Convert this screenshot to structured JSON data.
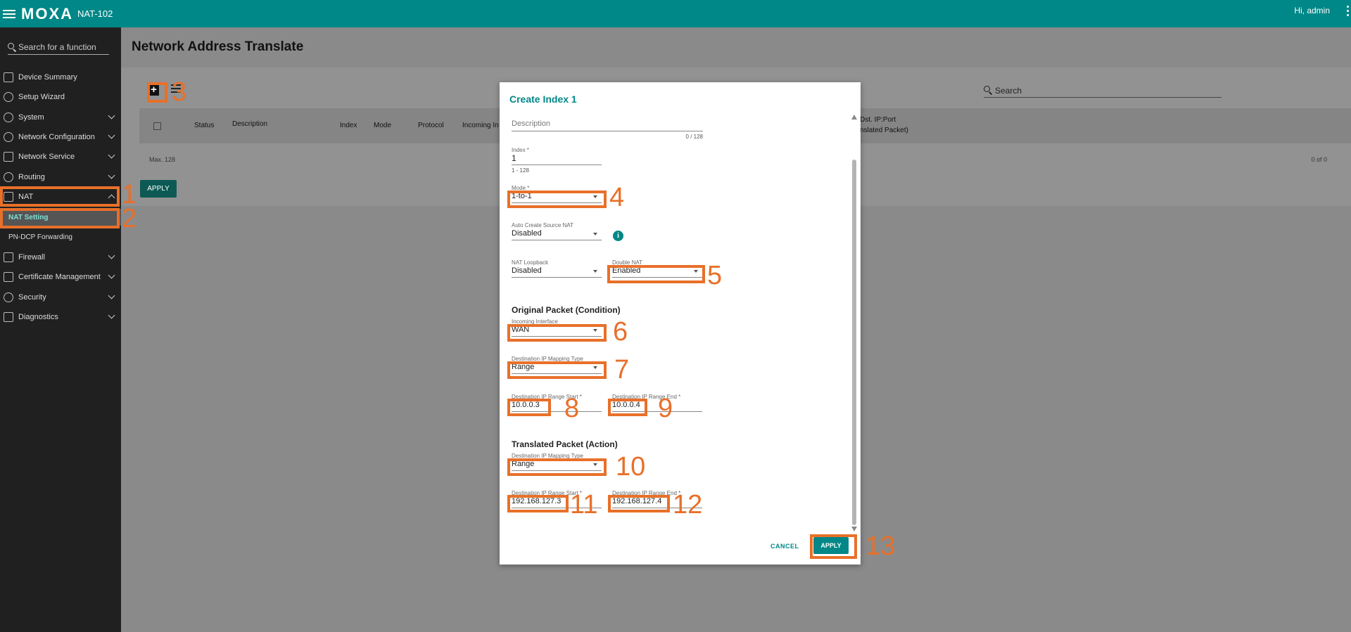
{
  "header": {
    "brand": "MOXA",
    "model": "NAT-102",
    "user_greeting": "Hi, admin"
  },
  "sidebar": {
    "search_placeholder": "Search for a function",
    "items": [
      {
        "label": "Device Summary",
        "icon": "device-summary-icon"
      },
      {
        "label": "Setup Wizard",
        "icon": "wand-icon"
      },
      {
        "label": "System",
        "icon": "gear-icon"
      },
      {
        "label": "Network Configuration",
        "icon": "network-config-icon"
      },
      {
        "label": "Network Service",
        "icon": "network-service-icon"
      },
      {
        "label": "Routing",
        "icon": "routing-icon"
      },
      {
        "label": "NAT",
        "icon": "nat-icon"
      },
      {
        "label": "NAT Setting"
      },
      {
        "label": "PN-DCP Forwarding"
      },
      {
        "label": "Firewall",
        "icon": "firewall-icon"
      },
      {
        "label": "Certificate Management",
        "icon": "certificate-icon"
      },
      {
        "label": "Security",
        "icon": "security-icon"
      },
      {
        "label": "Diagnostics",
        "icon": "diagnostics-icon"
      }
    ]
  },
  "main": {
    "title": "Network Address Translate",
    "search_placeholder": "Search",
    "columns": [
      "Status",
      "Description",
      "Index",
      "Mode",
      "Protocol",
      "Incoming In",
      "Dst. IP:Port",
      "nslated Packet)"
    ],
    "max_label": "Max. 128",
    "count_label": "0 of 0",
    "apply_label": "APPLY"
  },
  "modal": {
    "title": "Create Index 1",
    "description": {
      "placeholder": "Description",
      "counter": "0 / 128"
    },
    "index": {
      "label": "Index *",
      "value": "1",
      "helper": "1 - 128"
    },
    "mode": {
      "label": "Mode *",
      "value": "1-to-1"
    },
    "auto_create_source_nat": {
      "label": "Auto Create Source NAT",
      "value": "Disabled"
    },
    "nat_loopback": {
      "label": "NAT Loopback",
      "value": "Disabled"
    },
    "double_nat": {
      "label": "Double NAT",
      "value": "Enabled"
    },
    "original_section": "Original Packet (Condition)",
    "incoming_interface": {
      "label": "Incoming Interface",
      "value": "WAN"
    },
    "orig_dest_mapping_type": {
      "label": "Destination IP Mapping Type",
      "value": "Range"
    },
    "orig_range_start": {
      "label": "Destination IP Range Start *",
      "value": "10.0.0.3"
    },
    "orig_range_end": {
      "label": "Destination IP Range End *",
      "value": "10.0.0.4"
    },
    "translated_section": "Translated Packet (Action)",
    "trans_dest_mapping_type": {
      "label": "Destination IP Mapping Type",
      "value": "Range"
    },
    "trans_range_start": {
      "label": "Destination IP Range Start *",
      "value": "192.168.127.3"
    },
    "trans_range_end": {
      "label": "Destination IP Range End *",
      "value": "192.168.127.4"
    },
    "cancel_label": "CANCEL",
    "apply_label": "APPLY"
  },
  "annotations": {
    "color": "#e8702a",
    "numbers": [
      "1",
      "2",
      "3",
      "4",
      "5",
      "6",
      "7",
      "8",
      "9",
      "10",
      "11",
      "12",
      "13"
    ]
  },
  "colors": {
    "topbar": "#008787",
    "accent": "#008787",
    "sidebar": "#202020"
  }
}
